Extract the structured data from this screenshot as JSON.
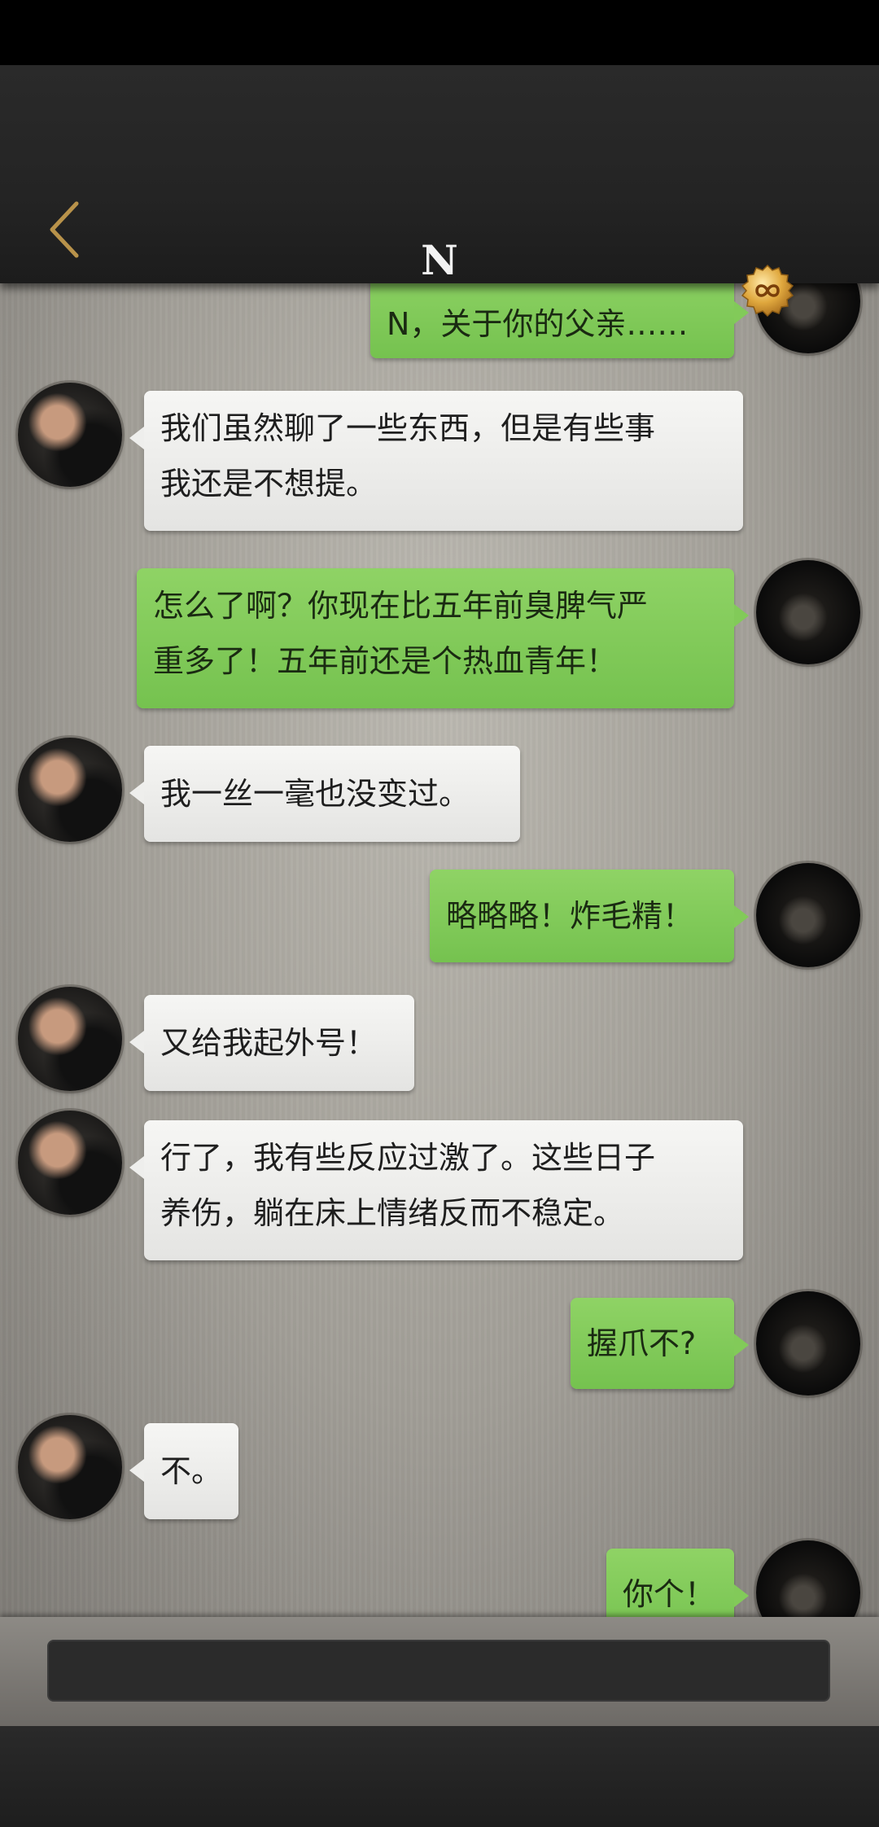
{
  "header": {
    "title": "N"
  },
  "icons": {
    "back": "chevron-left-icon",
    "badge": "infinity-coin-icon"
  },
  "colors": {
    "accent_gold": "#c9a04a",
    "bubble_me": "#7cc653",
    "bubble_npc": "#eeeeec"
  },
  "messages": [
    {
      "from": "me",
      "text": "N，关于你的父亲……"
    },
    {
      "from": "npc",
      "lines": [
        "我们虽然聊了一些东西，但是有些事",
        "我还是不想提。"
      ]
    },
    {
      "from": "me",
      "lines": [
        "怎么了啊？你现在比五年前臭脾气严",
        "重多了！五年前还是个热血青年！"
      ]
    },
    {
      "from": "npc",
      "text": "我一丝一毫也没变过。"
    },
    {
      "from": "me",
      "text": "略略略！炸毛精！"
    },
    {
      "from": "npc",
      "text": "又给我起外号！"
    },
    {
      "from": "npc",
      "lines": [
        "行了，我有些反应过激了。这些日子",
        "养伤，躺在床上情绪反而不稳定。"
      ]
    },
    {
      "from": "me",
      "text": "握爪不?"
    },
    {
      "from": "npc",
      "text": "不。"
    },
    {
      "from": "me",
      "text": "你个！"
    }
  ],
  "input": {
    "value": "",
    "placeholder": ""
  }
}
